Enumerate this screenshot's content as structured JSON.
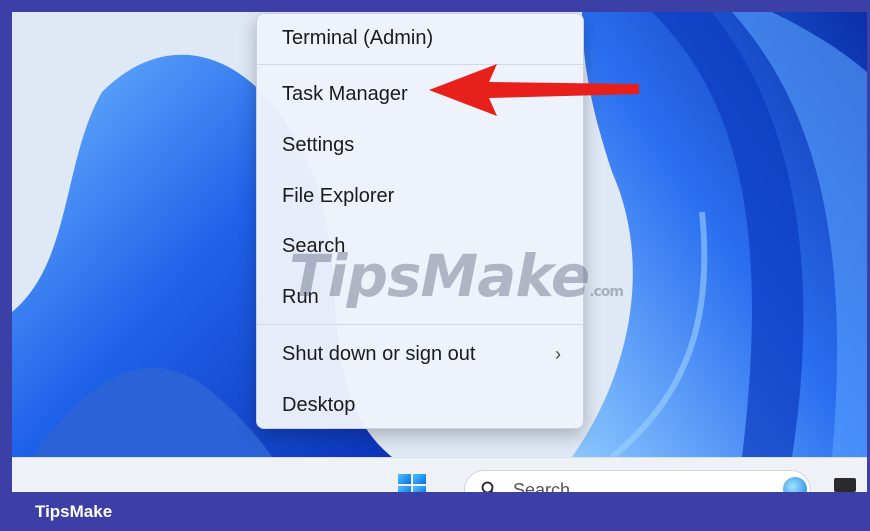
{
  "context_menu": {
    "items": [
      {
        "label": "Terminal (Admin)"
      },
      {
        "label": "Task Manager"
      },
      {
        "label": "Settings"
      },
      {
        "label": "File Explorer"
      },
      {
        "label": "Search"
      },
      {
        "label": "Run"
      },
      {
        "label": "Shut down or sign out",
        "chevron": "›"
      },
      {
        "label": "Desktop"
      }
    ]
  },
  "taskbar": {
    "search_placeholder": "Search",
    "icons": [
      "windows-start-icon",
      "search-icon",
      "copilot-icon"
    ]
  },
  "annotation": {
    "arrow_color": "#e8201c",
    "points_to": "Task Manager"
  },
  "watermark": {
    "text": "TipsMake",
    "suffix": ".com"
  },
  "footer": {
    "label": "TipsMake"
  },
  "colors": {
    "frame": "#3b3fa6",
    "wallpaper_blue": "#1f5fe8"
  }
}
